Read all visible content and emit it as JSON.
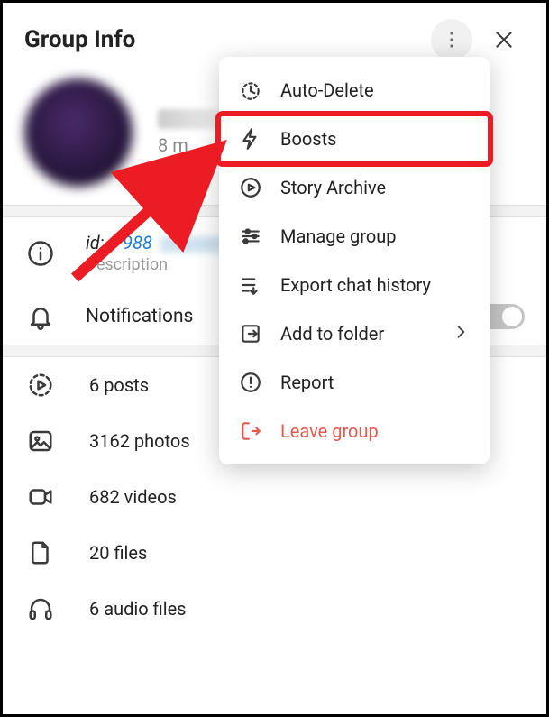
{
  "header": {
    "title": "Group Info"
  },
  "profile": {
    "members_text": "8 m",
    "avatar_color": "#2a1840"
  },
  "info": {
    "id_prefix": "id:",
    "id_value": "1 988",
    "desc_label": "Description",
    "notifications_label": "Notifications"
  },
  "media": {
    "posts": "6 posts",
    "photos": "3162 photos",
    "videos": "682 videos",
    "files": "20 files",
    "audio": "6 audio files"
  },
  "menu": {
    "auto_delete": "Auto-Delete",
    "boosts": "Boosts",
    "story_archive": "Story Archive",
    "manage": "Manage group",
    "export": "Export chat history",
    "add_folder": "Add to folder",
    "report": "Report",
    "leave": "Leave group"
  },
  "annotation": {
    "highlight_color": "#ec1c24"
  }
}
